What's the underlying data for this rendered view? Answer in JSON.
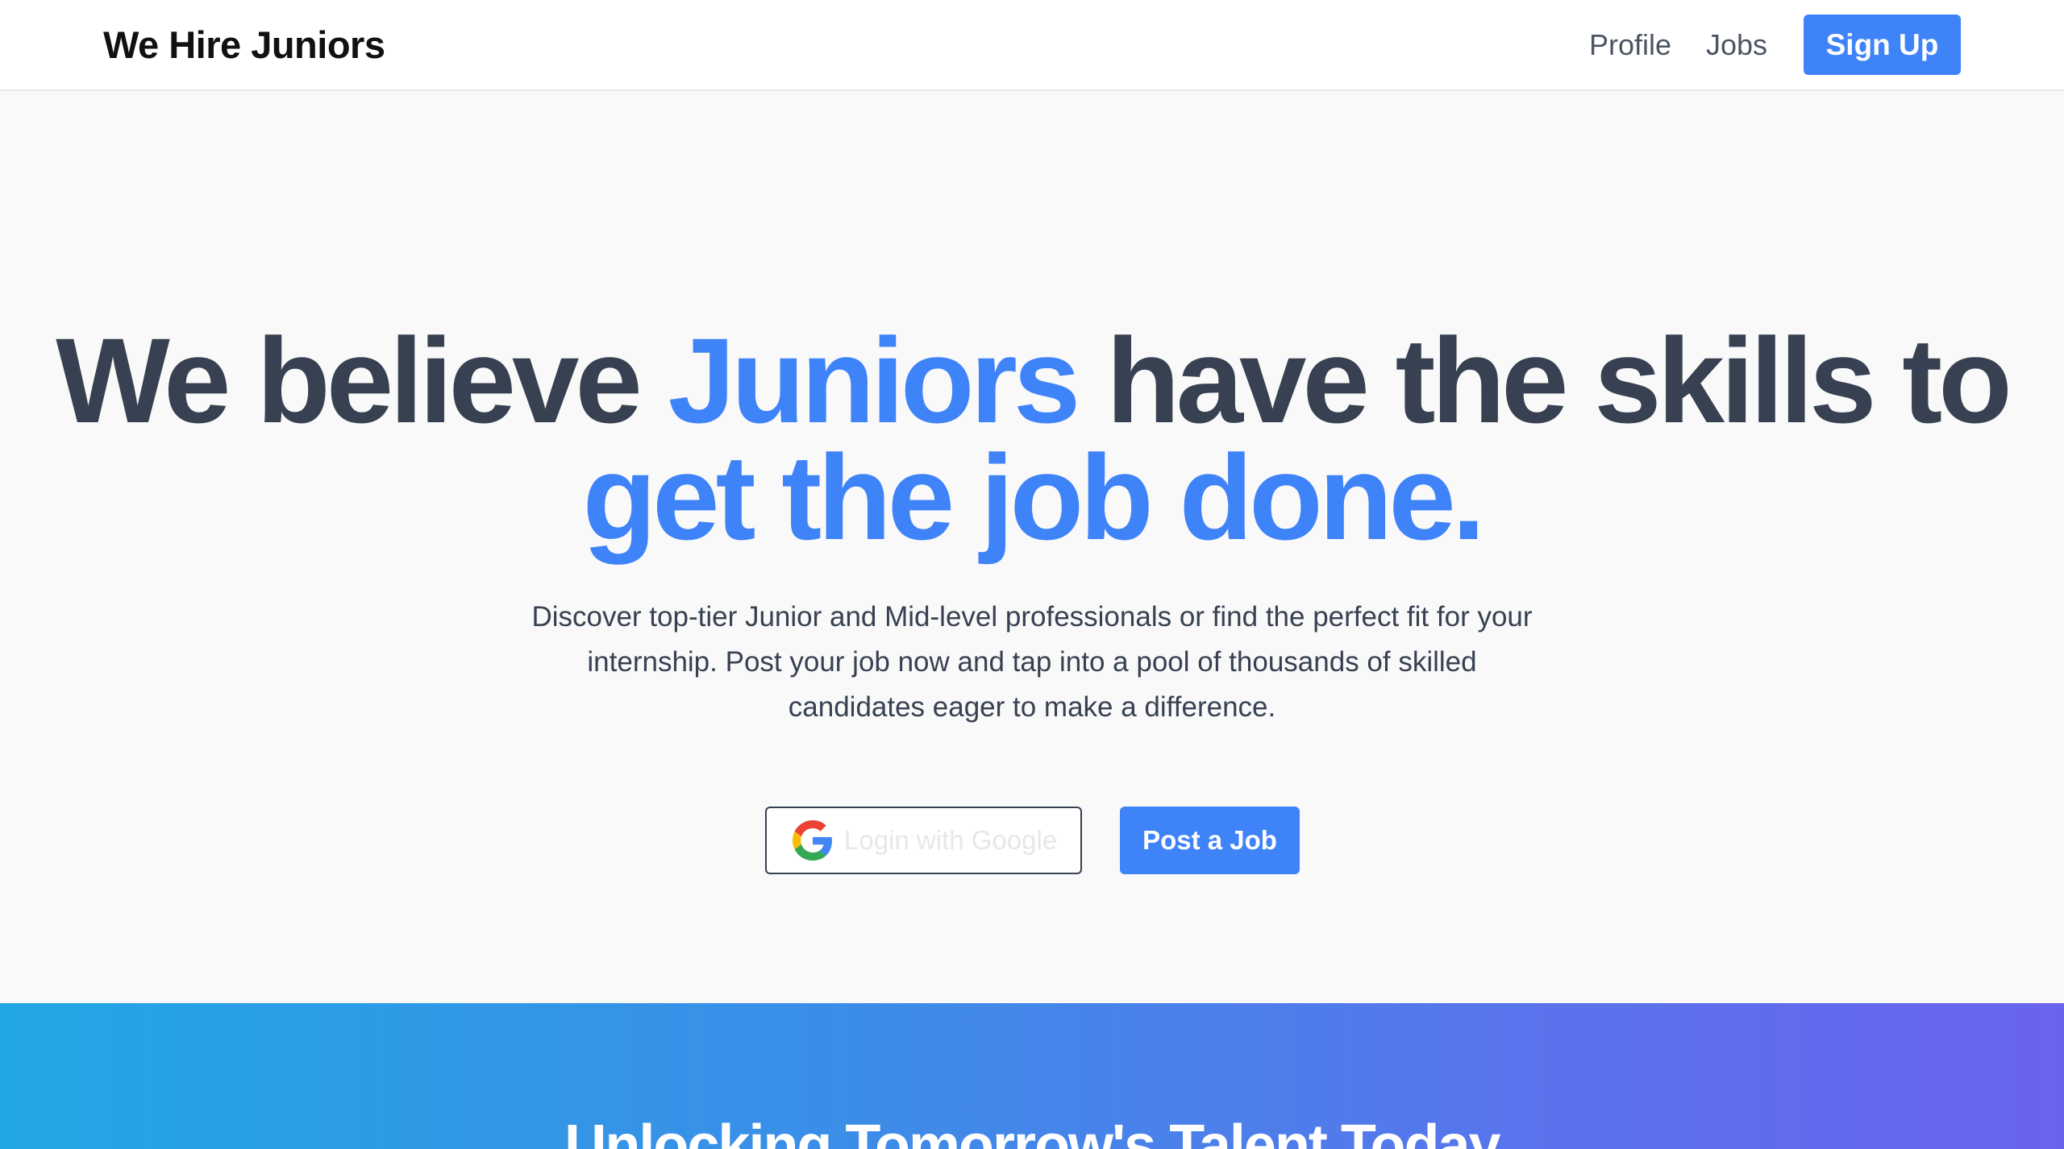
{
  "header": {
    "brand": "We Hire Juniors",
    "nav": {
      "profile": "Profile",
      "jobs": "Jobs",
      "signup": "Sign Up"
    }
  },
  "hero": {
    "title_part1": "We believe ",
    "title_accent1": "Juniors",
    "title_part2": " have the skills to ",
    "title_accent2": "get the job done.",
    "subtitle": "Discover top-tier Junior and Mid-level professionals or find the perfect fit for your internship. Post your job now and tap into a pool of thousands of skilled candidates eager to make a difference.",
    "google_button": "Login with Google",
    "post_button": "Post a Job"
  },
  "band": {
    "title": "Unlocking Tomorrow's Talent Today"
  },
  "colors": {
    "accent": "#3f83f8",
    "text": "#374151",
    "background": "#f9f9f9"
  },
  "icons": {
    "google": "google-g-icon"
  }
}
